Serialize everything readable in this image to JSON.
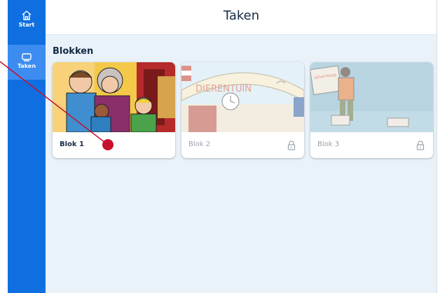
{
  "sidebar": {
    "items": [
      {
        "label": "Start",
        "icon": "home-icon"
      },
      {
        "label": "Taken",
        "icon": "tasks-icon"
      }
    ]
  },
  "header": {
    "title": "Taken"
  },
  "section": {
    "title": "Blokken"
  },
  "cards": [
    {
      "label": "Blok 1",
      "locked": false
    },
    {
      "label": "Blok 2",
      "locked": true
    },
    {
      "label": "Blok 3",
      "locked": true
    }
  ],
  "colors": {
    "sidebar": "#0f6fe0",
    "sidebar_active": "#3d8cf0",
    "background": "#e9f1f9",
    "pointer": "#c8102e"
  }
}
